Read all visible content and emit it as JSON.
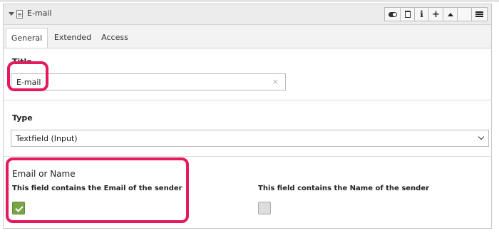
{
  "header": {
    "title": "E-mail",
    "buttons": [
      {
        "name": "toggle-visibility-button",
        "icon": "toggle-icon"
      },
      {
        "name": "delete-button",
        "icon": "trash-icon"
      },
      {
        "name": "info-button",
        "icon": "info-icon",
        "glyph": "i"
      },
      {
        "name": "add-button",
        "icon": "plus-icon",
        "glyph": "+"
      },
      {
        "name": "move-up-button",
        "icon": "arrow-up-icon"
      },
      {
        "name": "empty-button",
        "icon": ""
      },
      {
        "name": "drag-menu-button",
        "icon": "menu-icon"
      }
    ]
  },
  "tabs": [
    {
      "label": "General",
      "active": true
    },
    {
      "label": "Extended",
      "active": false
    },
    {
      "label": "Access",
      "active": false
    }
  ],
  "title_field": {
    "label": "Title",
    "value": "E-mail",
    "clear_glyph": "×"
  },
  "type_field": {
    "label": "Type",
    "value": "Textfield (Input)"
  },
  "email_or_name": {
    "heading": "Email or Name",
    "email_option": {
      "label": "This field contains the Email of the sender",
      "checked": true
    },
    "name_option": {
      "label": "This field contains the Name of the sender",
      "checked": false
    }
  },
  "colors": {
    "highlight": "#e5195c",
    "checked": "#79a548",
    "header_bg": "#ececec"
  }
}
